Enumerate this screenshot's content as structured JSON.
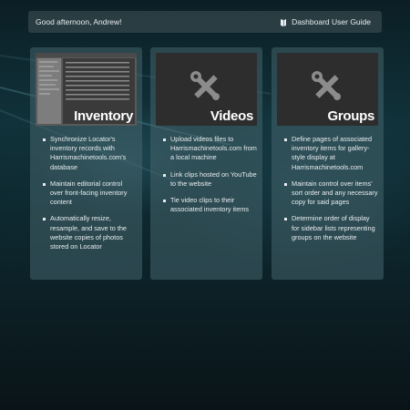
{
  "header": {
    "greeting": "Good afternoon, Andrew!",
    "guide_label": "Dashboard User Guide",
    "guide_icon": "book-icon"
  },
  "cards": [
    {
      "title": "Inventory",
      "thumbnail": "screenshot",
      "bullets": [
        "Synchronize Locator's inventory records with Harrismachinetools.com's database",
        "Maintain editorial control over front-facing inventory content",
        "Automatically resize, resample, and save to the website copies of photos stored on Locator"
      ]
    },
    {
      "title": "Videos",
      "thumbnail": "tools-icon",
      "bullets": [
        "Upload videos files to Harrismachinetools.com from a local machine",
        "Link clips hosted on YouTube to the website",
        "Tie video clips to their associated inventory items"
      ]
    },
    {
      "title": "Groups",
      "thumbnail": "tools-icon",
      "bullets": [
        "Define pages of associated inventory items for gallery-style display at Harrismachinetools.com",
        "Maintain control over items' sort order and any necessary copy for said pages",
        "Determine order of display for sidebar lists representing groups on the website"
      ]
    }
  ]
}
